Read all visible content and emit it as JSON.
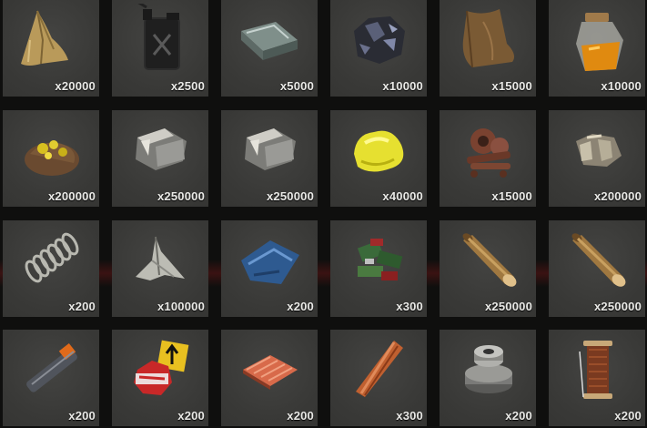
{
  "inventory": {
    "slots": [
      {
        "icon": "cloth-icon",
        "quantity": "x20000"
      },
      {
        "icon": "low-grade-fuel-icon",
        "quantity": "x2500"
      },
      {
        "icon": "metal-fragments-icon",
        "quantity": "x5000"
      },
      {
        "icon": "charcoal-icon",
        "quantity": "x10000"
      },
      {
        "icon": "leather-icon",
        "quantity": "x15000"
      },
      {
        "icon": "animal-fat-icon",
        "quantity": "x10000"
      },
      {
        "icon": "metal-ore-icon",
        "quantity": "x200000"
      },
      {
        "icon": "stones-icon",
        "quantity": "x250000"
      },
      {
        "icon": "stones-icon",
        "quantity": "x250000"
      },
      {
        "icon": "sulfur-icon",
        "quantity": "x40000"
      },
      {
        "icon": "scrap-icon",
        "quantity": "x15000"
      },
      {
        "icon": "bone-fragments-icon",
        "quantity": "x200000"
      },
      {
        "icon": "metal-spring-icon",
        "quantity": "x200"
      },
      {
        "icon": "metal-blade-icon",
        "quantity": "x100000"
      },
      {
        "icon": "tarp-icon",
        "quantity": "x200"
      },
      {
        "icon": "tech-trash-icon",
        "quantity": "x300"
      },
      {
        "icon": "wood-icon",
        "quantity": "x250000"
      },
      {
        "icon": "wood-icon",
        "quantity": "x250000"
      },
      {
        "icon": "metal-pipe-icon",
        "quantity": "x200"
      },
      {
        "icon": "road-signs-icon",
        "quantity": "x200"
      },
      {
        "icon": "sheet-metal-icon",
        "quantity": "x200"
      },
      {
        "icon": "rope-icon",
        "quantity": "x300"
      },
      {
        "icon": "gears-icon",
        "quantity": "x200"
      },
      {
        "icon": "sewing-kit-icon",
        "quantity": "x200"
      }
    ]
  },
  "colors": {
    "slot": "#3a3a38",
    "background": "#0f0f0e",
    "quantity_text": "#e9e9e6"
  }
}
